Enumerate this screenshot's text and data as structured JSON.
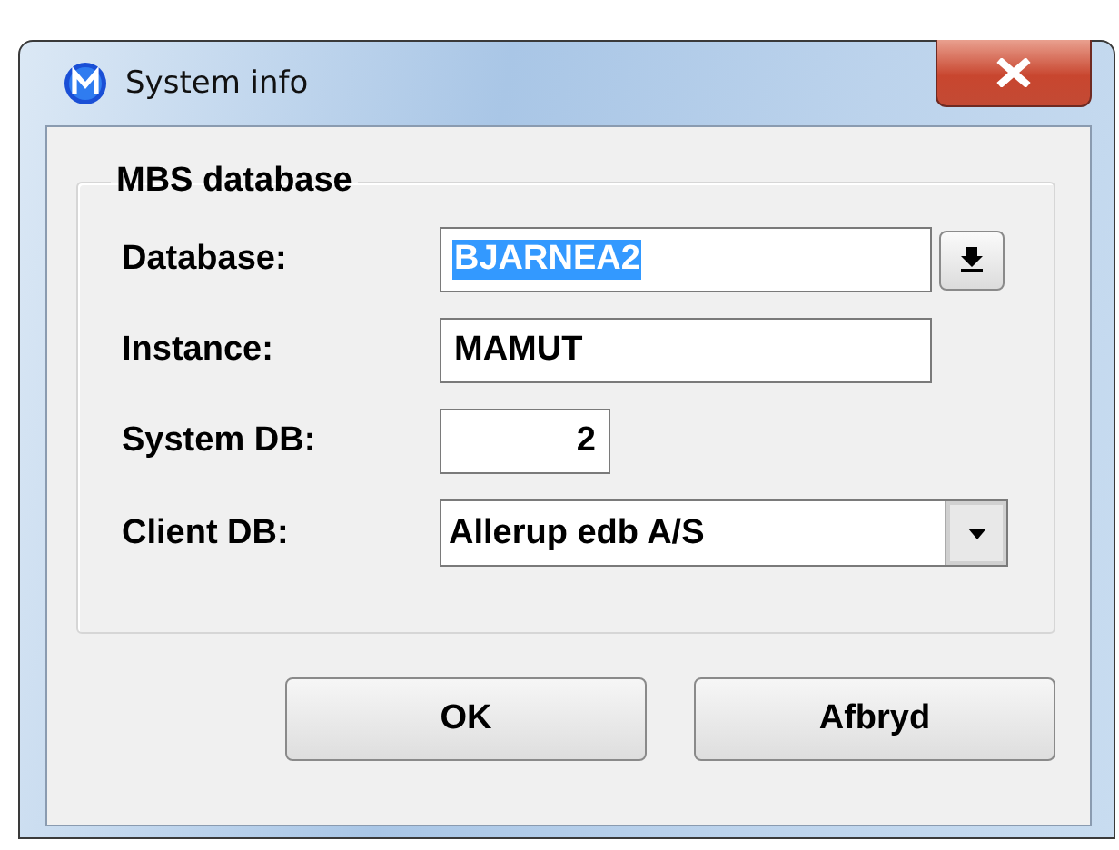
{
  "window": {
    "title": "System info"
  },
  "group": {
    "title": "MBS database",
    "fields": [
      {
        "kind": "picker",
        "label": "Database:",
        "value": "BJARNEA2",
        "text_selected": true
      },
      {
        "kind": "text",
        "label": "Instance:",
        "value": "MAMUT",
        "text_selected": false
      },
      {
        "kind": "number",
        "label": "System DB:",
        "value": "2",
        "text_selected": false
      },
      {
        "kind": "combo",
        "label": "Client DB:",
        "value": "Allerup edb A/S",
        "text_selected": false
      }
    ]
  },
  "buttons": [
    "OK",
    "Afbryd"
  ]
}
